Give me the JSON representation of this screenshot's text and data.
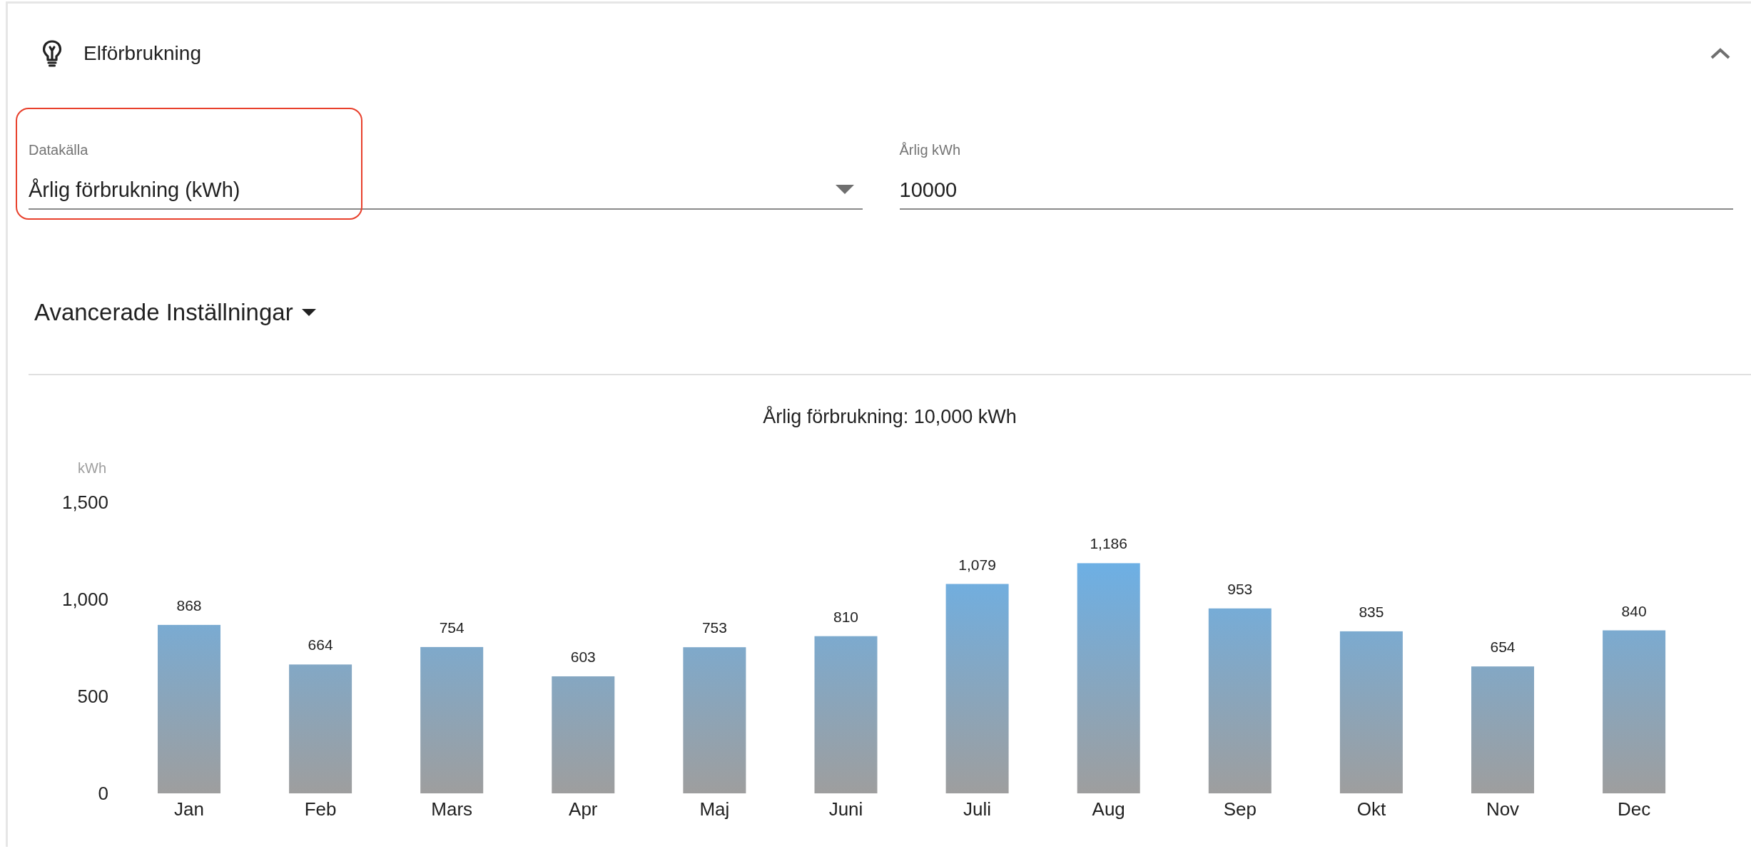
{
  "card": {
    "title": "Elförbrukning",
    "expanded": true
  },
  "fields": [
    {
      "kind": "select",
      "label": "Datakälla",
      "value": "Årlig förbrukning (kWh)",
      "highlighted": true
    },
    {
      "kind": "text",
      "label": "Årlig kWh",
      "value": "10000",
      "highlighted": false
    }
  ],
  "advanced": {
    "label": "Avancerade Inställningar",
    "expanded": false
  },
  "chart": {
    "title": "Årlig förbrukning: 10,000 kWh",
    "chart_data": {
      "type": "bar",
      "ylabel": "kWh",
      "categories": [
        "Jan",
        "Feb",
        "Mars",
        "Apr",
        "Maj",
        "Juni",
        "Juli",
        "Aug",
        "Sep",
        "Okt",
        "Nov",
        "Dec"
      ],
      "values": [
        868,
        664,
        754,
        603,
        753,
        810,
        1079,
        1186,
        953,
        835,
        654,
        840
      ],
      "value_labels": [
        "868",
        "664",
        "754",
        "603",
        "753",
        "810",
        "1,079",
        "1,186",
        "953",
        "835",
        "654",
        "840"
      ],
      "ylim": [
        0,
        1500
      ],
      "yticks": [
        {
          "value": 0,
          "label": "0"
        },
        {
          "value": 500,
          "label": "500"
        },
        {
          "value": 1000,
          "label": "1,000"
        },
        {
          "value": 1500,
          "label": "1,500"
        }
      ],
      "data_labels": true
    }
  }
}
